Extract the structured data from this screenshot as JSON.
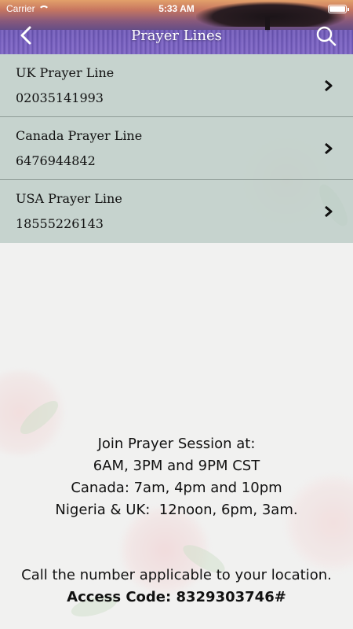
{
  "status_bar": {
    "carrier": "Carrier",
    "time": "5:33 AM"
  },
  "nav": {
    "title": "Prayer Lines",
    "back_icon": "chevron-left-icon",
    "search_icon": "search-icon"
  },
  "prayer_lines": [
    {
      "name": "UK Prayer Line",
      "number": "02035141993"
    },
    {
      "name": "Canada Prayer Line",
      "number": "6476944842"
    },
    {
      "name": "USA Prayer Line",
      "number": "18555226143"
    }
  ],
  "info": {
    "line1": "Join Prayer Session at:",
    "line2": "6AM, 3PM and 9PM CST",
    "line3": "Canada: 7am, 4pm and 10pm",
    "line4": "Nigeria & UK:  12noon, 6pm, 3am."
  },
  "call_to_action": {
    "text": "Call the number applicable to your location.",
    "access_code": "Access Code: 8329303746#"
  },
  "colors": {
    "row_background": "#bacbc4",
    "page_background": "#f1f1f0",
    "text": "#111111"
  }
}
